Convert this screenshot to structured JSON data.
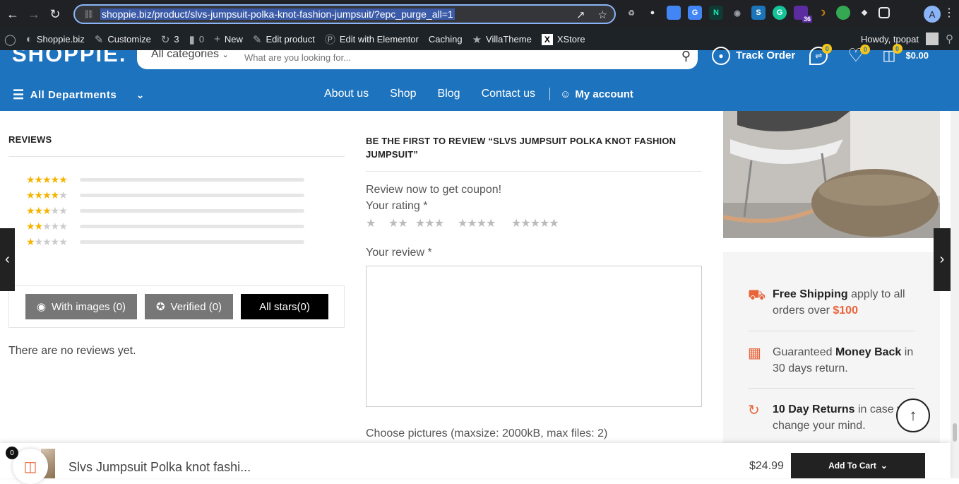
{
  "browser": {
    "url": "shoppie.biz/product/slvs-jumpsuit-polka-knot-fashion-jumpsuit/?epc_purge_all=1",
    "profile_initial": "A",
    "ext_badge": "36"
  },
  "wpbar": {
    "site": "Shoppie.biz",
    "customize": "Customize",
    "updates": "3",
    "comments": "0",
    "new": "New",
    "edit_product": "Edit product",
    "elementor": "Edit with Elementor",
    "caching": "Caching",
    "villatheme": "VillaTheme",
    "xstore": "XStore",
    "howdy": "Howdy, tpopat"
  },
  "header": {
    "logo": "SHOPPIE.",
    "category": "All categories",
    "search_placeholder": "What are you looking for...",
    "track_order": "Track Order",
    "compare_count": "0",
    "wishlist_count": "0",
    "cart_count": "0",
    "cart_total": "$0.00",
    "departments": "All Departments",
    "nav": [
      "About us",
      "Shop",
      "Blog",
      "Contact us"
    ],
    "my_account": "My account"
  },
  "reviews": {
    "heading": "REVIEWS",
    "filters": {
      "images": "With images (0)",
      "verified": "Verified (0)",
      "all": "All stars(0)"
    },
    "no_reviews": "There are no reviews yet."
  },
  "review_form": {
    "heading_line1": "BE THE FIRST TO REVIEW “SLVS JUMPSUIT POLKA KNOT FASHION",
    "heading_line2": "JUMPSUIT”",
    "coupon": "Review now to get coupon!",
    "rating_label": "Your rating *",
    "review_label": "Your review *",
    "pictures_label": "Choose pictures (maxsize: 2000kB, max files: 2)"
  },
  "features": {
    "shipping_bold": "Free Shipping",
    "shipping_text": " apply to all orders over ",
    "shipping_amount": "$100",
    "money_pre": "Guaranteed ",
    "money_bold": "Money Back",
    "money_text": " in 30 days return.",
    "returns_bold": "10 Day Returns",
    "returns_text": " in case you change your mind."
  },
  "sticky": {
    "title": "Slvs Jumpsuit Polka knot fashi...",
    "price": "$24.99",
    "add_to_cart": "Add To Cart",
    "cart_count": "0"
  },
  "colors": {
    "brand": "#1e73be",
    "accent": "#e8643a",
    "star": "#f5b400"
  }
}
